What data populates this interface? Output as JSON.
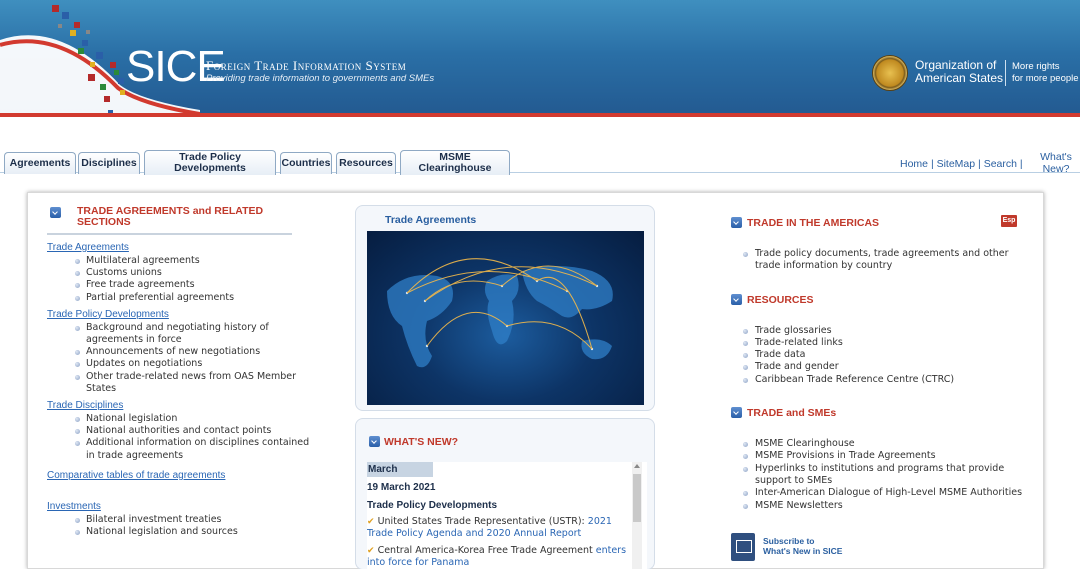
{
  "banner": {
    "logo_text": "SICE",
    "title": "Foreign Trade Information System",
    "subtitle": "Providing trade information to governments and SMEs",
    "org_line1": "Organization of",
    "org_line2": "American States",
    "motto_line1": "More rights",
    "motto_line2": "for more people"
  },
  "tabs": [
    {
      "label": "Agreements"
    },
    {
      "label": "Disciplines"
    },
    {
      "label_line1": "Trade Policy",
      "label_line2": "Developments"
    },
    {
      "label": "Countries"
    },
    {
      "label": "Resources"
    },
    {
      "label_line1": "MSME",
      "label_line2": "Clearinghouse"
    }
  ],
  "top_links": {
    "home": "Home",
    "sitemap": "SiteMap",
    "search": "Search",
    "sep": "|",
    "whats_new_line1": "What's",
    "whats_new_line2": "New?"
  },
  "left": {
    "heading_line1": "TRADE AGREEMENTS and RELATED",
    "heading_line2": "SECTIONS",
    "trade_agreements": {
      "title": "Trade Agreements",
      "items": [
        "Multilateral agreements",
        "Customs unions",
        "Free trade agreements",
        "Partial preferential agreements"
      ]
    },
    "trade_policy": {
      "title": "Trade Policy Developments",
      "items": [
        "Background and negotiating history of agreements in force",
        "Announcements of new negotiations",
        "Updates on negotiations",
        "Other trade-related news from OAS Member States"
      ]
    },
    "trade_disciplines": {
      "title": "Trade Disciplines",
      "items": [
        "National legislation",
        "National authorities and contact points",
        "Additional information on disciplines contained in trade agreements"
      ]
    },
    "comparative": "Comparative tables of trade agreements",
    "investments": {
      "title": "Investments",
      "items": [
        "Bilateral investment treaties",
        "National legislation and sources"
      ]
    }
  },
  "middle": {
    "trade_agreements_title": "Trade Agreements",
    "whats_new_title": "WHAT'S NEW?",
    "month": "March",
    "date": "19 March 2021",
    "category": "Trade Policy Developments",
    "item1_prefix": "United States Trade Representative (USTR): ",
    "item1_link": "2021 Trade Policy Agenda and 2020 Annual Report",
    "item2_prefix": "Central America-Korea Free Trade Agreement ",
    "item2_link": "enters into force for Panama"
  },
  "right": {
    "americas": {
      "title": "TRADE IN THE AMERICAS",
      "esp": "Esp",
      "items": [
        "Trade policy documents, trade agreements and other trade information by country"
      ]
    },
    "resources": {
      "title": "RESOURCES",
      "items": [
        "Trade glossaries",
        "Trade-related links",
        "Trade data",
        "Trade and gender",
        "Caribbean Trade Reference Centre (CTRC)"
      ]
    },
    "smes": {
      "title": "TRADE and SMEs",
      "items": [
        "MSME Clearinghouse",
        "MSME Provisions in Trade Agreements",
        "Hyperlinks to institutions and programs that provide support to SMEs",
        "Inter-American Dialogue of High-Level MSME Authorities",
        "MSME Newsletters"
      ]
    },
    "subscribe_line1": "Subscribe to",
    "subscribe_line2": "What's New in SICE"
  },
  "colors": {
    "accent_red": "#c0392b",
    "link_blue": "#2a66b4",
    "banner_blue": "#2a6fa6"
  }
}
